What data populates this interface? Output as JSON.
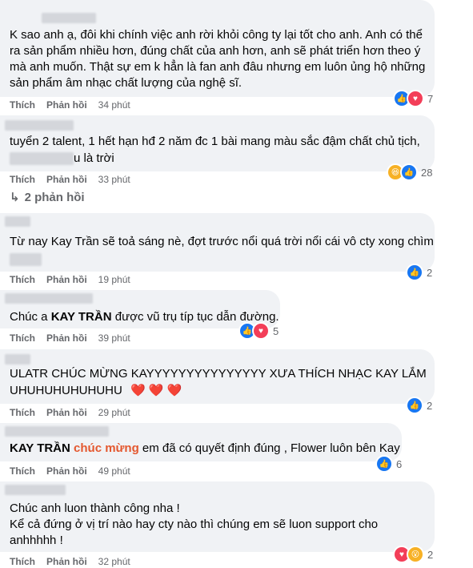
{
  "comments": [
    {
      "lines": [
        "K sao anh ạ, đôi khi chính việc anh rời khỏi công ty lại tốt cho anh. Anh có thể",
        "ra sản phẩm nhiều hơn, đúng chất của anh hơn, anh sẽ phát triển hơn theo ý",
        "mà anh muốn. Thật sự em k hẳn là fan anh đâu nhưng em luôn ủng hộ những",
        "sản phẩm âm nhạc chất lượng của nghệ sĩ."
      ],
      "like": "Thích",
      "reply": "Phản hồi",
      "time": "34 phút",
      "reactions": "7"
    },
    {
      "lines": [
        "tuyển 2 talent, 1 hết hạn hđ 2 năm đc 1 bài mang màu sắc đậm chất chủ tịch,",
        "u là trời"
      ],
      "like": "Thích",
      "reply": "Phản hồi",
      "time": "33 phút",
      "reactions": "28",
      "replies_label": "2 phản hồi"
    },
    {
      "lines": [
        "Từ nay Kay Trần sẽ toả sáng nè, đợt trước nổi quá trời nổi cái vô cty xong chìm"
      ],
      "like": "Thích",
      "reply": "Phản hồi",
      "time": "19 phút",
      "reactions": "2"
    },
    {
      "prefix": "Chúc a ",
      "mention": "KAY TRẦN",
      "suffix": " được vũ trụ típ tục dẫn đường.",
      "like": "Thích",
      "reply": "Phản hồi",
      "time": "39 phút",
      "reactions": "5"
    },
    {
      "lines": [
        "ULATR CHÚC MỪNG KAYYYYYYYYYYYYYYY XƯA THÍCH NHẠC KAY LẮM",
        "UHUHUHUHUHUHU"
      ],
      "hearts": "❤️ ❤️ ❤️",
      "like": "Thích",
      "reply": "Phản hồi",
      "time": "29 phút",
      "reactions": "2"
    },
    {
      "mention": "KAY TRẦN",
      "highlight": "chúc mừng",
      "suffix": " em đã có quyết định đúng , Flower luôn bên Kay",
      "like": "Thích",
      "reply": "Phản hồi",
      "time": "49 phút",
      "reactions": "6"
    },
    {
      "lines": [
        "Chúc anh luon thành công nha !",
        "Kể cả đứng ở vị trí nào hay cty nào thì chúng em sẽ luon support cho",
        "anhhhhh !"
      ],
      "like": "Thích",
      "reply": "Phản hồi",
      "time": "32 phút",
      "reactions": "2"
    }
  ],
  "icons": {
    "reply_arrow": "reply-arrow-icon",
    "like": "like-reaction-icon",
    "love": "love-reaction-icon",
    "haha": "haha-reaction-icon",
    "wow": "wow-reaction-icon"
  },
  "colors": {
    "bubble": "#f0f2f5",
    "meta": "#65676b",
    "like": "#1877f2",
    "love": "#f33e58",
    "highlight": "#e4572e"
  }
}
